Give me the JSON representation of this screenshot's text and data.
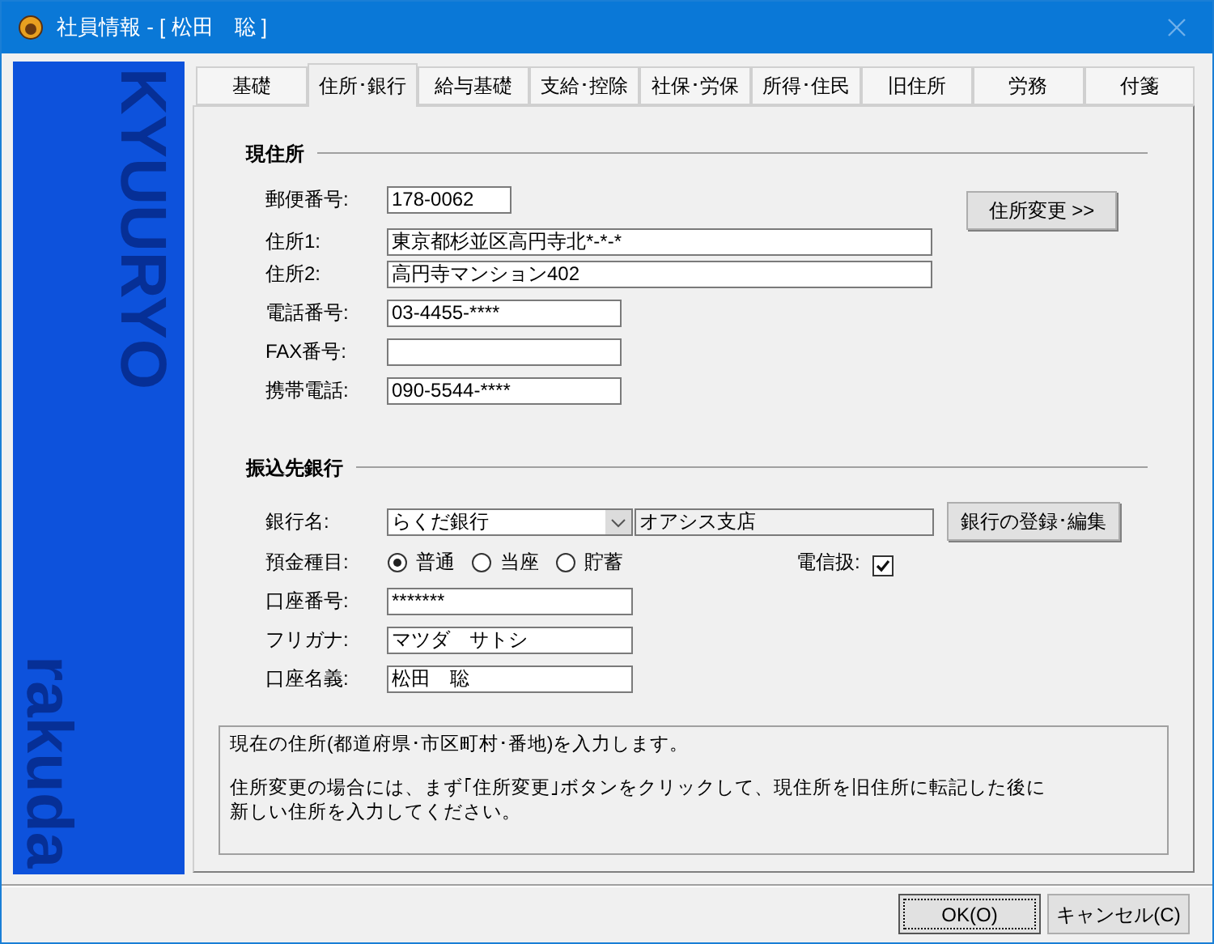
{
  "window": {
    "title": "社員情報 - [ 松田　聡 ]"
  },
  "banner": {
    "top_text": "KYUURYO",
    "bottom_text": "rakuda"
  },
  "tabs": [
    {
      "label": "基礎",
      "selected": false
    },
    {
      "label": "住所･銀行",
      "selected": true
    },
    {
      "label": "給与基礎",
      "selected": false
    },
    {
      "label": "支給･控除",
      "selected": false
    },
    {
      "label": "社保･労保",
      "selected": false
    },
    {
      "label": "所得･住民",
      "selected": false
    },
    {
      "label": "旧住所",
      "selected": false
    },
    {
      "label": "労務",
      "selected": false
    },
    {
      "label": "付箋",
      "selected": false
    }
  ],
  "current_address": {
    "title": "現住所",
    "button": "住所変更 >>",
    "fields": [
      {
        "label": "郵便番号:",
        "value": "178-0062",
        "kind": "short"
      },
      {
        "label": "住所1:",
        "value": "東京都杉並区高円寺北*-*-*",
        "kind": "long"
      },
      {
        "label": "住所2:",
        "value": "高円寺マンション402",
        "kind": "long"
      },
      {
        "label": "電話番号:",
        "value": "03-4455-****",
        "kind": "medium"
      },
      {
        "label": "FAX番号:",
        "kind": "medium"
      },
      {
        "label": "携帯電話:",
        "value": "090-5544-****",
        "kind": "medium"
      }
    ]
  },
  "bank": {
    "title": "振込先銀行",
    "bank_label": "銀行名:",
    "bank_name": "らくだ銀行",
    "branch": "オアシス支店",
    "register_button": "銀行の登録･編集",
    "account_type": {
      "label": "預金種目:",
      "options": [
        {
          "label": "普通",
          "selected": true
        },
        {
          "label": "当座",
          "selected": false
        },
        {
          "label": "貯蓄",
          "selected": false
        }
      ]
    },
    "wire_transfer": {
      "label": "電信扱:",
      "checked": true
    },
    "fields": [
      {
        "label": "口座番号:",
        "value": "*******"
      },
      {
        "label": "フリガナ:",
        "value": "マツダ　サトシ"
      },
      {
        "label": "口座名義:",
        "value": "松田　聡"
      }
    ]
  },
  "help": [
    "現在の住所(都道府県･市区町村･番地)を入力します。",
    "住所変更の場合には、まず｢住所変更｣ボタンをクリックして、現住所を旧住所に転記した後に",
    "新しい住所を入力してください。"
  ],
  "buttons": [
    {
      "label": "OK(O)",
      "default": true
    },
    {
      "label": "キャンセル(C)",
      "default": false
    }
  ]
}
